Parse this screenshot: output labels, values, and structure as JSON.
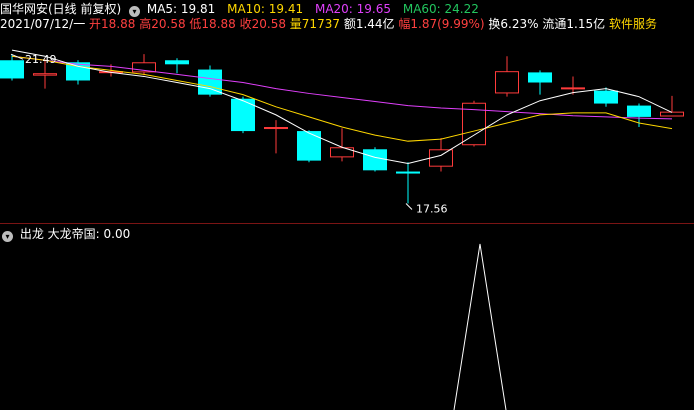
{
  "header": {
    "title": "国华网安(日线 前复权)",
    "ma": [
      {
        "label": "MA5: 19.81",
        "color": "#ffffff"
      },
      {
        "label": "MA10: 19.41",
        "color": "#ffd700"
      },
      {
        "label": "MA20: 19.65",
        "color": "#e040fb"
      },
      {
        "label": "MA60: 24.22",
        "color": "#22c55e"
      }
    ]
  },
  "quote": {
    "date": "2021/07/12/一",
    "open": "开18.88",
    "high": "高20.58",
    "low": "低18.88",
    "close": "收20.58",
    "volume": "量71737",
    "amount": "额1.44亿",
    "change": "幅1.87(9.99%)",
    "turnover": "换6.23%",
    "float": "流通1.15亿",
    "sector": "软件服务"
  },
  "panel2": {
    "name": "出龙",
    "indicator": "大龙帝国: 0.00"
  },
  "colors": {
    "up": "#ff3b3b",
    "down": "#00ffff",
    "ma5": "#ffffff",
    "ma10": "#ffd700",
    "ma20": "#e040fb",
    "text_red": "#ff4040",
    "yellow": "#ffd700"
  },
  "chart_data": [
    {
      "type": "candlestick",
      "annotations": {
        "high_label": "21.49",
        "low_label": "17.56"
      },
      "candles": [
        {
          "o": 21.1,
          "c": 20.65,
          "h": 21.25,
          "l": 20.6
        },
        {
          "o": 20.72,
          "c": 20.78,
          "h": 21.12,
          "l": 20.4
        },
        {
          "o": 21.05,
          "c": 20.6,
          "h": 21.1,
          "l": 20.5
        },
        {
          "o": 20.8,
          "c": 20.83,
          "h": 21.0,
          "l": 20.7
        },
        {
          "o": 20.8,
          "c": 21.05,
          "h": 21.25,
          "l": 20.73
        },
        {
          "o": 21.1,
          "c": 21.0,
          "h": 21.15,
          "l": 20.78
        },
        {
          "o": 20.87,
          "c": 20.25,
          "h": 20.97,
          "l": 20.2
        },
        {
          "o": 20.15,
          "c": 19.35,
          "h": 20.2,
          "l": 19.3
        },
        {
          "o": 19.4,
          "c": 19.45,
          "h": 19.62,
          "l": 18.8
        },
        {
          "o": 19.35,
          "c": 18.62,
          "h": 19.37,
          "l": 18.58
        },
        {
          "o": 18.7,
          "c": 18.95,
          "h": 19.42,
          "l": 18.6
        },
        {
          "o": 18.9,
          "c": 18.38,
          "h": 18.95,
          "l": 18.35
        },
        {
          "o": 18.35,
          "c": 18.3,
          "h": 18.58,
          "l": 17.56
        },
        {
          "o": 18.47,
          "c": 18.9,
          "h": 19.18,
          "l": 18.35
        },
        {
          "o": 19.0,
          "c": 20.05,
          "h": 20.1,
          "l": 18.97
        },
        {
          "o": 20.28,
          "c": 20.83,
          "h": 21.2,
          "l": 20.2
        },
        {
          "o": 20.8,
          "c": 20.55,
          "h": 20.85,
          "l": 20.25
        },
        {
          "o": 20.4,
          "c": 20.43,
          "h": 20.7,
          "l": 20.25
        },
        {
          "o": 20.35,
          "c": 20.03,
          "h": 20.43,
          "l": 19.95
        },
        {
          "o": 19.98,
          "c": 19.7,
          "h": 20.03,
          "l": 19.45
        },
        {
          "o": 19.71,
          "c": 19.83,
          "h": 20.22,
          "l": 19.78
        }
      ],
      "ma5": [
        21.35,
        21.2,
        20.95,
        20.8,
        20.7,
        20.55,
        20.4,
        20.1,
        19.75,
        19.3,
        18.95,
        18.7,
        18.55,
        18.75,
        19.25,
        19.75,
        20.1,
        20.3,
        20.4,
        20.2,
        19.81
      ],
      "ma10": [
        21.2,
        21.1,
        20.95,
        20.85,
        20.75,
        20.6,
        20.45,
        20.25,
        19.95,
        19.7,
        19.45,
        19.25,
        19.1,
        19.15,
        19.35,
        19.55,
        19.75,
        19.8,
        19.8,
        19.55,
        19.41
      ],
      "ma20": [
        21.2,
        21.1,
        21.0,
        20.95,
        20.85,
        20.75,
        20.65,
        20.55,
        20.4,
        20.28,
        20.18,
        20.08,
        19.98,
        19.92,
        19.88,
        19.83,
        19.78,
        19.73,
        19.7,
        19.67,
        19.65
      ],
      "y_range": [
        17.35,
        21.65
      ]
    },
    {
      "type": "line",
      "series": [
        {
          "name": "大龙帝国",
          "values": [
            0,
            0,
            0,
            0,
            0,
            0,
            0,
            0,
            0,
            0,
            0,
            0,
            0,
            0,
            1,
            0,
            0,
            0,
            0,
            0,
            0
          ]
        }
      ]
    }
  ]
}
